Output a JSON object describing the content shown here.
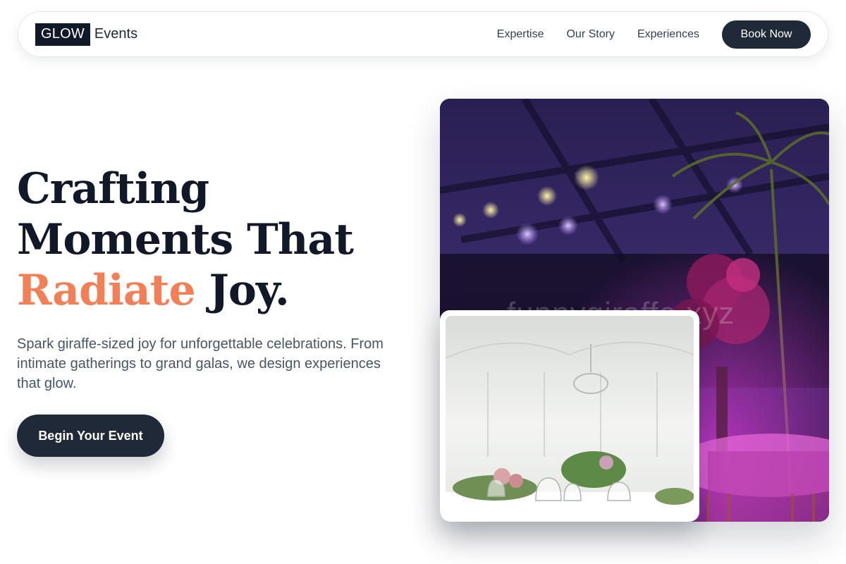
{
  "brand": {
    "box": "GLOW",
    "text": "Events"
  },
  "nav": {
    "links": [
      "Expertise",
      "Our Story",
      "Experiences"
    ],
    "cta": "Book Now"
  },
  "hero": {
    "line1": "Crafting",
    "line2": "Moments That",
    "accent": "Radiate",
    "line3_end": " Joy.",
    "subtext": "Spark giraffe-sized joy for unforgettable celebrations. From intimate gatherings to grand galas, we design experiences that glow.",
    "cta": "Begin Your Event"
  },
  "images": {
    "watermark": "funnygiraffe.xyz"
  },
  "colors": {
    "primary": "#1f2937",
    "accent": "#f27f55",
    "text": "#111827",
    "muted": "#475569"
  }
}
